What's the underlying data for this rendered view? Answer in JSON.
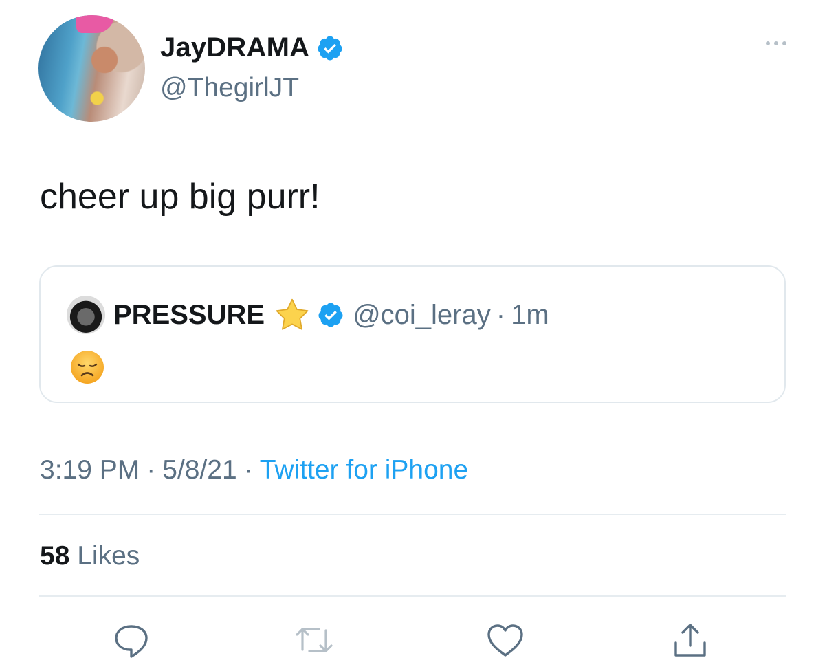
{
  "author": {
    "display_name": "JayDRAMA",
    "handle": "@ThegirlJT",
    "verified": true
  },
  "tweet": {
    "text": "cheer up big purr!"
  },
  "quoted_tweet": {
    "display_name": "PRESSURE",
    "handle": "@coi_leray",
    "dot": "·",
    "time": "1m",
    "verified": true,
    "name_emoji": "star",
    "body_emoji": "disappointed-face"
  },
  "meta": {
    "time": "3:19 PM",
    "sep": "·",
    "date": "5/8/21",
    "source": "Twitter for iPhone"
  },
  "stats": {
    "likes_count": "58",
    "likes_label": "Likes"
  },
  "colors": {
    "verified_blue": "#1da1f2",
    "muted_text": "#5b7083",
    "link": "#1da1f2"
  }
}
